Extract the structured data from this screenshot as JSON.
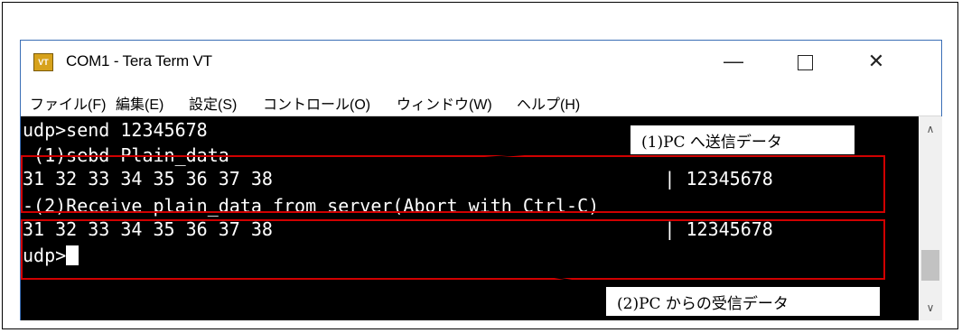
{
  "window": {
    "icon_text": "VT",
    "title": "COM1 - Tera Term VT",
    "minimize_symbol": "—",
    "close_symbol": "✕"
  },
  "menu": {
    "items": [
      {
        "label": "ファイル(F)"
      },
      {
        "label": "編集(E)"
      },
      {
        "label": "設定(S)"
      },
      {
        "label": "コントロール(O)"
      },
      {
        "label": "ウィンドウ(W)"
      },
      {
        "label": "ヘルプ(H)"
      }
    ]
  },
  "terminal": {
    "lines": [
      "udp>send 12345678",
      "-(1)sebd Plain_data",
      "31 32 33 34 35 36 37 38                                    | 12345678",
      "-(2)Receive plain_data from server(Abort with Ctrl-C)",
      "31 32 33 34 35 36 37 38                                    | 12345678",
      "udp>"
    ]
  },
  "scrollbar": {
    "up_arrow": "∧",
    "down_arrow": "∨"
  },
  "annotations": {
    "callout1": "(1)PC へ送信データ",
    "callout2": "(2)PC からの受信データ",
    "highlight_color": "#d00000"
  }
}
